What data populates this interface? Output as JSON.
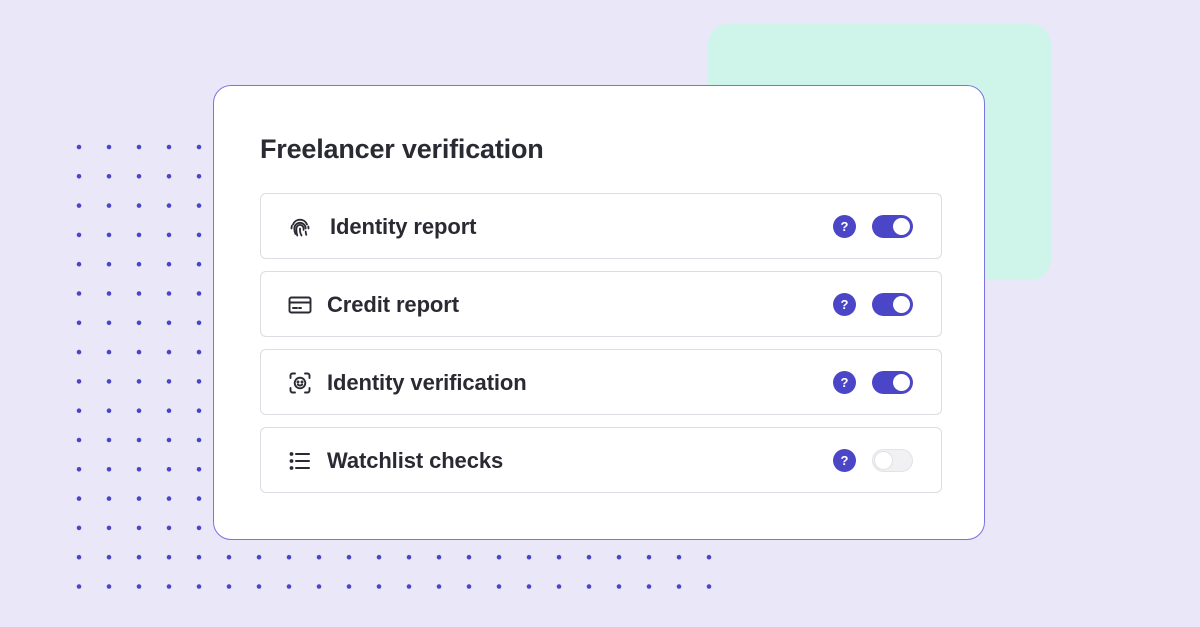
{
  "panel": {
    "title": "Freelancer verification",
    "items": [
      {
        "label": "Identity report",
        "icon": "fingerprint-icon",
        "help": "?",
        "enabled": true
      },
      {
        "label": "Credit report",
        "icon": "credit-card-icon",
        "help": "?",
        "enabled": true
      },
      {
        "label": "Identity verification",
        "icon": "face-scan-icon",
        "help": "?",
        "enabled": true
      },
      {
        "label": "Watchlist checks",
        "icon": "list-icon",
        "help": "?",
        "enabled": false
      }
    ]
  },
  "colors": {
    "accent": "#4b45c8",
    "background": "#e9e7f8",
    "mint": "#cff5ea",
    "card_border": "#7a73e0"
  }
}
